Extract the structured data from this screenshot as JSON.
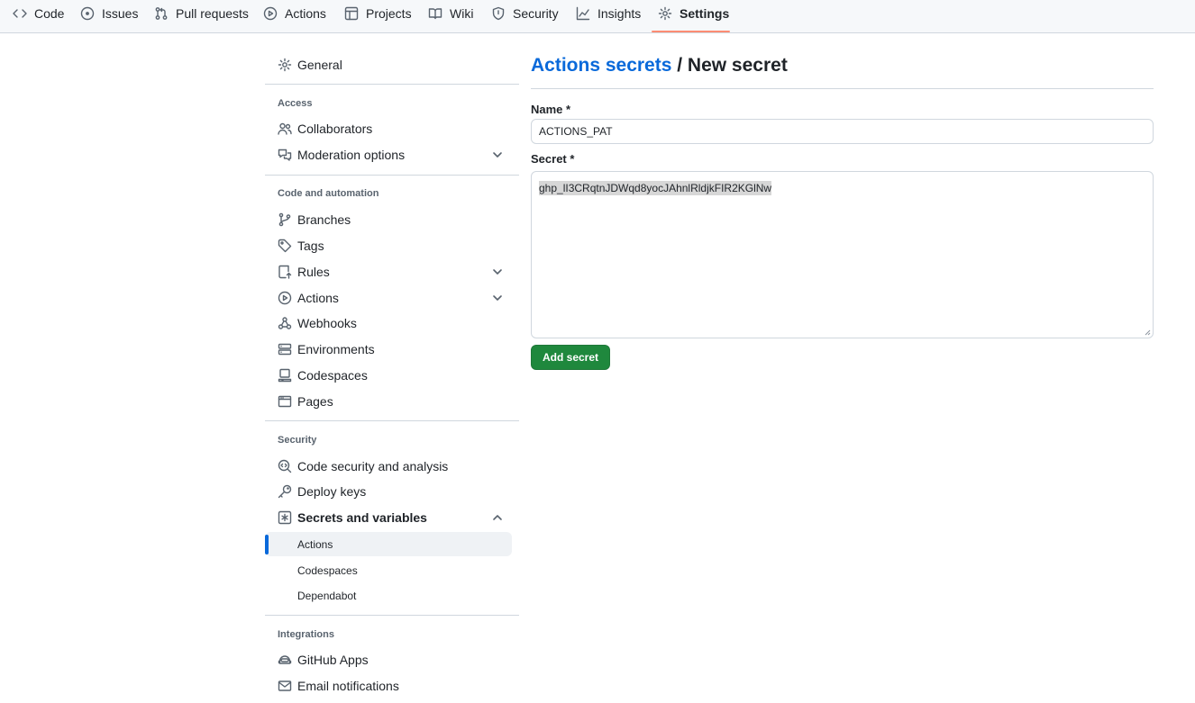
{
  "tabs": [
    {
      "label": "Code",
      "icon": "code-icon"
    },
    {
      "label": "Issues",
      "icon": "issue-opened-icon"
    },
    {
      "label": "Pull requests",
      "icon": "git-pull-request-icon"
    },
    {
      "label": "Actions",
      "icon": "play-icon"
    },
    {
      "label": "Projects",
      "icon": "table-icon"
    },
    {
      "label": "Wiki",
      "icon": "book-icon"
    },
    {
      "label": "Security",
      "icon": "shield-icon"
    },
    {
      "label": "Insights",
      "icon": "graph-icon"
    },
    {
      "label": "Settings",
      "icon": "gear-icon",
      "selected": true
    }
  ],
  "sidebar": {
    "general": "General",
    "access": {
      "heading": "Access",
      "items": [
        "Collaborators",
        "Moderation options"
      ]
    },
    "code_automation": {
      "heading": "Code and automation",
      "items": [
        "Branches",
        "Tags",
        "Rules",
        "Actions",
        "Webhooks",
        "Environments",
        "Codespaces",
        "Pages"
      ]
    },
    "security": {
      "heading": "Security",
      "items": [
        "Code security and analysis",
        "Deploy keys",
        "Secrets and variables"
      ],
      "sub_items": [
        "Actions",
        "Codespaces",
        "Dependabot"
      ],
      "active_sub_item": "Actions"
    },
    "integrations": {
      "heading": "Integrations",
      "items": [
        "GitHub Apps",
        "Email notifications"
      ]
    }
  },
  "main": {
    "breadcrumb_link": "Actions secrets",
    "breadcrumb_current": " / New secret",
    "name_label": "Name *",
    "name_value": "ACTIONS_PAT",
    "secret_label": "Secret *",
    "secret_value": "ghp_lI3CRqtnJDWqd8yocJAhnlRldjkFIR2KGlNw",
    "submit_label": "Add secret"
  },
  "colors": {
    "accent_link": "#0969da",
    "primary_button": "#1f883d",
    "tab_underline": "#fd8c73"
  }
}
